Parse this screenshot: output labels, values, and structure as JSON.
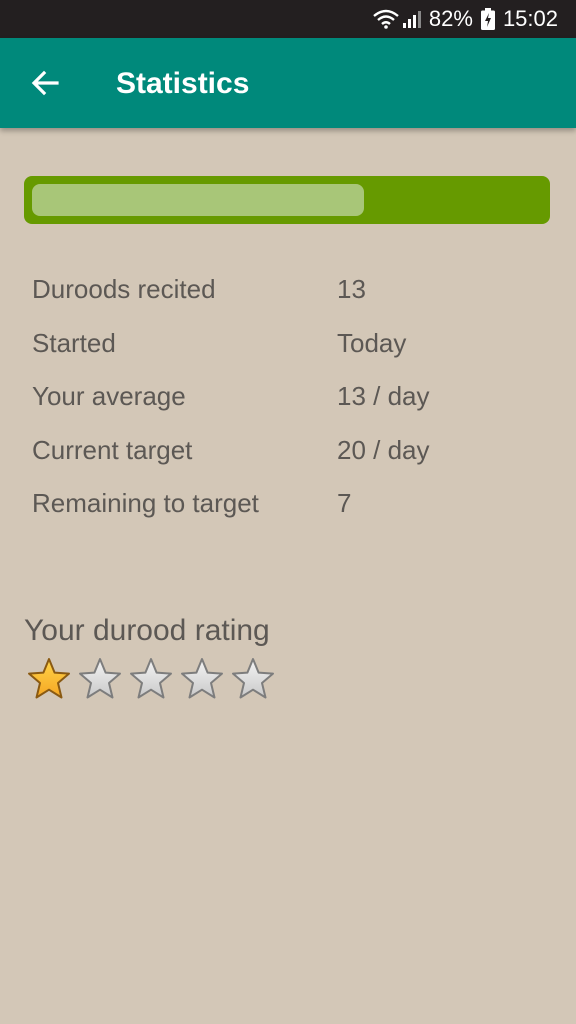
{
  "status_bar": {
    "battery": "82%",
    "time": "15:02",
    "icons": [
      "wifi-icon",
      "signal-icon",
      "battery-charging-icon"
    ]
  },
  "app_bar": {
    "title": "Statistics",
    "back_icon": "arrow-left-icon"
  },
  "progress": {
    "fraction": 0.65,
    "track_color": "#669a00",
    "fill_color": "#a8c678"
  },
  "stats": [
    {
      "label": "Duroods recited",
      "value": "13"
    },
    {
      "label": "Started",
      "value": "Today"
    },
    {
      "label": "Your average",
      "value": "13 / day"
    },
    {
      "label": "Current target",
      "value": "20 / day"
    },
    {
      "label": "Remaining to target",
      "value": "7"
    }
  ],
  "rating": {
    "title": "Your durood rating",
    "filled": 1,
    "max": 5
  },
  "colors": {
    "background": "#d3c7b7",
    "app_bar": "#00897b",
    "status_bar": "#231f20",
    "text": "#5c5854",
    "star_filled": "#f5a623",
    "star_empty": "#c9c9c9"
  }
}
